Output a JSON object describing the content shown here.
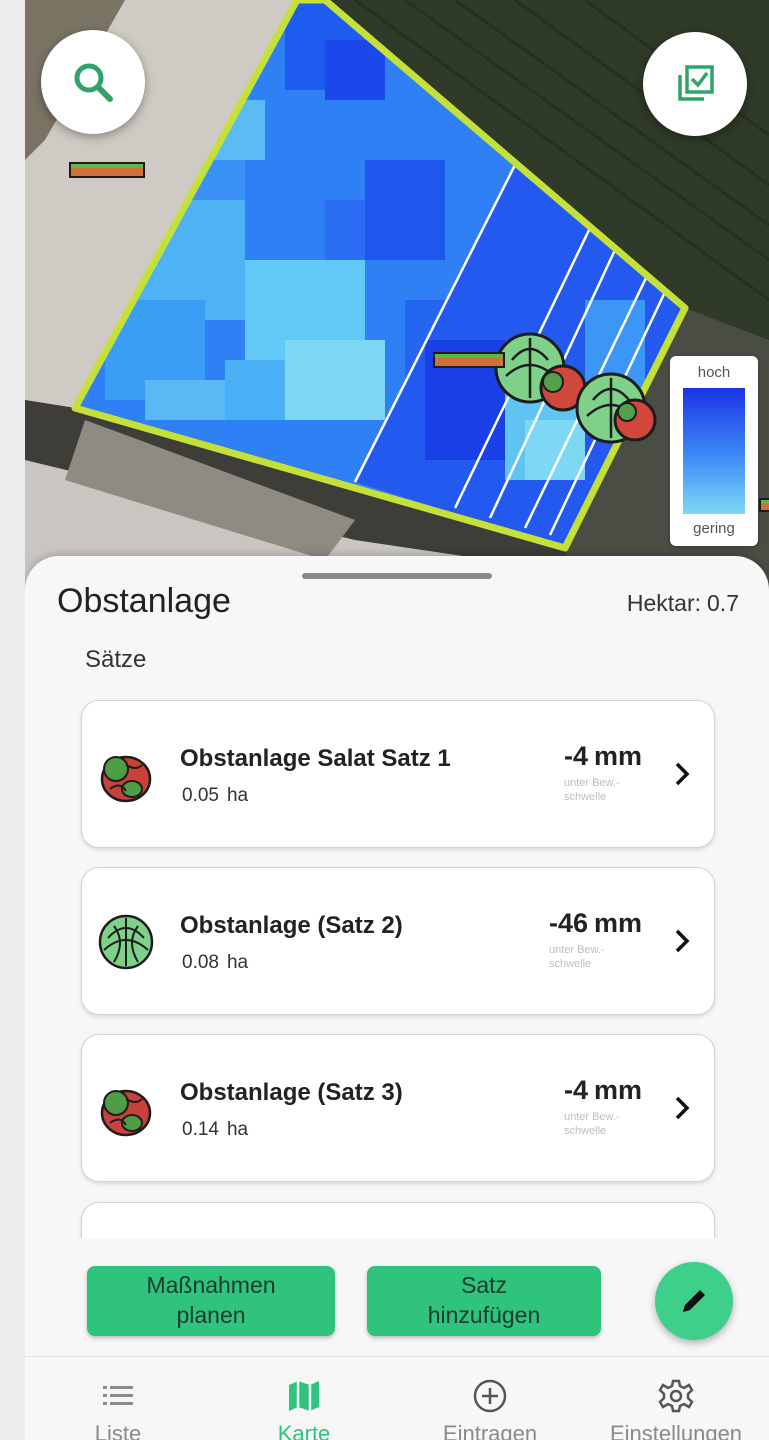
{
  "map": {
    "legend": {
      "high_label": "hoch",
      "low_label": "gering"
    }
  },
  "field": {
    "name": "Obstanlage",
    "hectare_label": "Hektar:",
    "hectare_value": "0.7"
  },
  "plantings": {
    "section_title": "Sätze",
    "items": [
      {
        "name": "Obstanlage Salat Satz 1",
        "area": "0.05",
        "area_unit": "ha",
        "deficit": "-4",
        "deficit_unit": "mm",
        "deficit_caption": "unter Bew.-schwelle",
        "crop_icon": "lettuce-icon"
      },
      {
        "name": "Obstanlage (Satz 2)",
        "area": "0.08",
        "area_unit": "ha",
        "deficit": "-46",
        "deficit_unit": "mm",
        "deficit_caption": "unter Bew.-schwelle",
        "crop_icon": "cabbage-icon"
      },
      {
        "name": "Obstanlage (Satz 3)",
        "area": "0.14",
        "area_unit": "ha",
        "deficit": "-4",
        "deficit_unit": "mm",
        "deficit_caption": "unter Bew.-schwelle",
        "crop_icon": "lettuce-icon"
      }
    ]
  },
  "actions": {
    "plan_line1": "Maßnahmen",
    "plan_line2": "planen",
    "add_line1": "Satz",
    "add_line2": "hinzufügen"
  },
  "tabbar": {
    "tabs": [
      {
        "label": "Liste",
        "icon": "list-icon",
        "active": false
      },
      {
        "label": "Karte",
        "icon": "map-icon",
        "active": true
      },
      {
        "label": "Eintragen",
        "icon": "add-circle-icon",
        "active": false
      },
      {
        "label": "Einstellungen",
        "icon": "gear-icon",
        "active": false
      }
    ]
  },
  "colors": {
    "accent": "#2fc37d",
    "field_outline": "#c6e03a",
    "moisture_high": "#1a33e6",
    "moisture_low": "#7ed8f4"
  }
}
